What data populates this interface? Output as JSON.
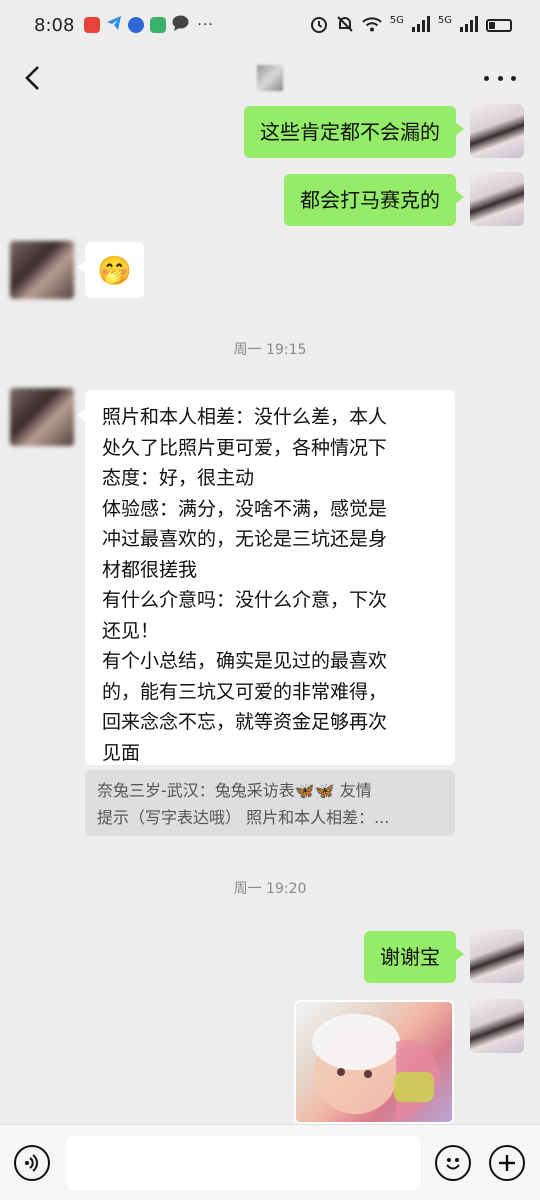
{
  "status_bar": {
    "time": "8:08",
    "net_label_1": "5G",
    "net_label_2": "5G",
    "icons": [
      "app-badge-icon",
      "telegram-icon",
      "circle-app-icon",
      "green-app-icon",
      "chat-bubble-icon",
      "more-dots-icon",
      "alarm-icon",
      "mute-icon",
      "wifi-icon",
      "signal-icon",
      "signal-icon",
      "battery-icon"
    ],
    "battery_level": 0.3
  },
  "nav": {
    "back_icon": "chevron-left-icon",
    "more_icon": "more-dots-icon"
  },
  "messages": {
    "m1": {
      "text": "这些肯定都不会漏的"
    },
    "m2": {
      "text": "都会打马赛克的"
    },
    "m3": {
      "emoji": "🤭"
    },
    "time1": "周一 19:15",
    "m4": {
      "text": "照片和本人相差：没什么差，本人\n处久了比照片更可爱，各种情况下\n态度：好，很主动\n体验感：满分，没啥不满，感觉是\n冲过最喜欢的，无论是三坑还是身\n材都很搓我\n有什么介意吗：没什么介意，下次\n还见！\n有个小总结，确实是见过的最喜欢\n的，能有三坑又可爱的非常难得，\n回来念念不忘，就等资金足够再次\n见面"
    },
    "quote": {
      "text": "奈兔三岁-武汉：兔兔采访表🦋🦋 友情\n提示（写字表达哦） 照片和本人相差：..."
    },
    "time2": "周一 19:20",
    "m5": {
      "text": "谢谢宝"
    }
  },
  "input_bar": {
    "voice_icon": "voice-icon",
    "emoji_icon": "smiley-icon",
    "plus_icon": "plus-icon",
    "placeholder": ""
  },
  "colors": {
    "background": "#ededed",
    "sent_bubble": "#95ec69",
    "received_bubble": "#ffffff"
  }
}
